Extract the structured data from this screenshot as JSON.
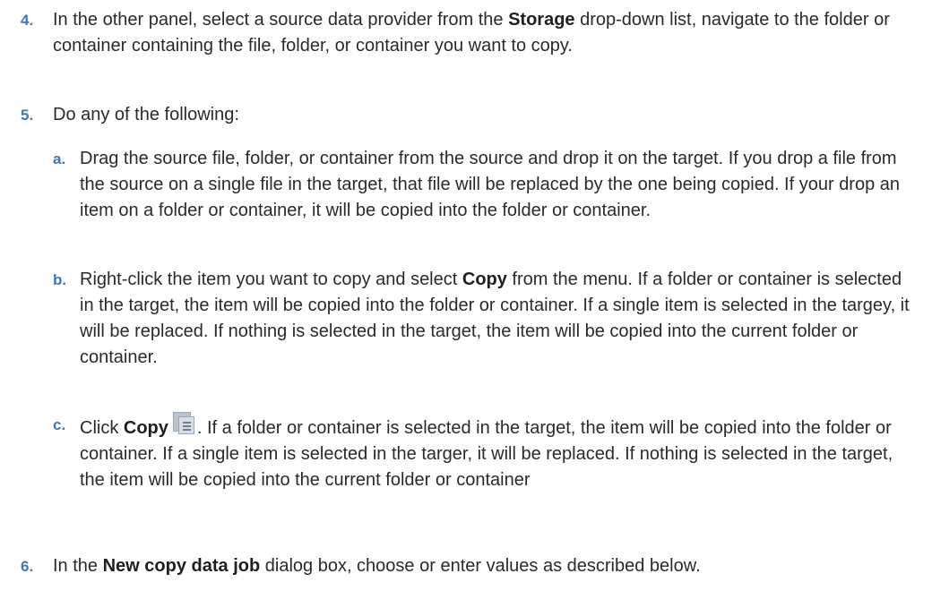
{
  "steps": [
    {
      "number": "4.",
      "parts": [
        "In the other panel, select a source data provider from the ",
        "Storage",
        " drop-down list, navigate to the folder or container containing the file, folder, or container you want to copy."
      ]
    },
    {
      "number": "5.",
      "text": "Do any of the following:",
      "substeps": [
        {
          "letter": "a.",
          "text": "Drag the source file, folder, or container from the source and drop it on the target. If you drop a file from the source on a single file in the target, that file will be replaced by the one being copied. If your drop an item on a folder or container, it will be copied into the folder or container."
        },
        {
          "letter": "b.",
          "parts": [
            "Right-click the item you want to copy and select ",
            "Copy",
            " from the menu. If a folder or container is selected in the target, the item will be copied into the folder or container. If a single item is selected in the targey, it will be replaced. If nothing is selected in the target, the item will be copied into the current folder or container."
          ]
        },
        {
          "letter": "c.",
          "parts": [
            "Click ",
            "Copy",
            ". If a folder or container is selected in the target, the item will be copied into the folder or container. If a single item is selected in the targer, it will be replaced. If nothing is selected in the target, the item will be copied into the current folder or container"
          ],
          "icon": "copy-icon"
        }
      ]
    },
    {
      "number": "6.",
      "parts": [
        "In the ",
        "New copy data job",
        " dialog box, choose or enter values as described below."
      ]
    }
  ],
  "colors": {
    "list_number": "#3f78b3",
    "body_text": "#2a2a2a"
  }
}
